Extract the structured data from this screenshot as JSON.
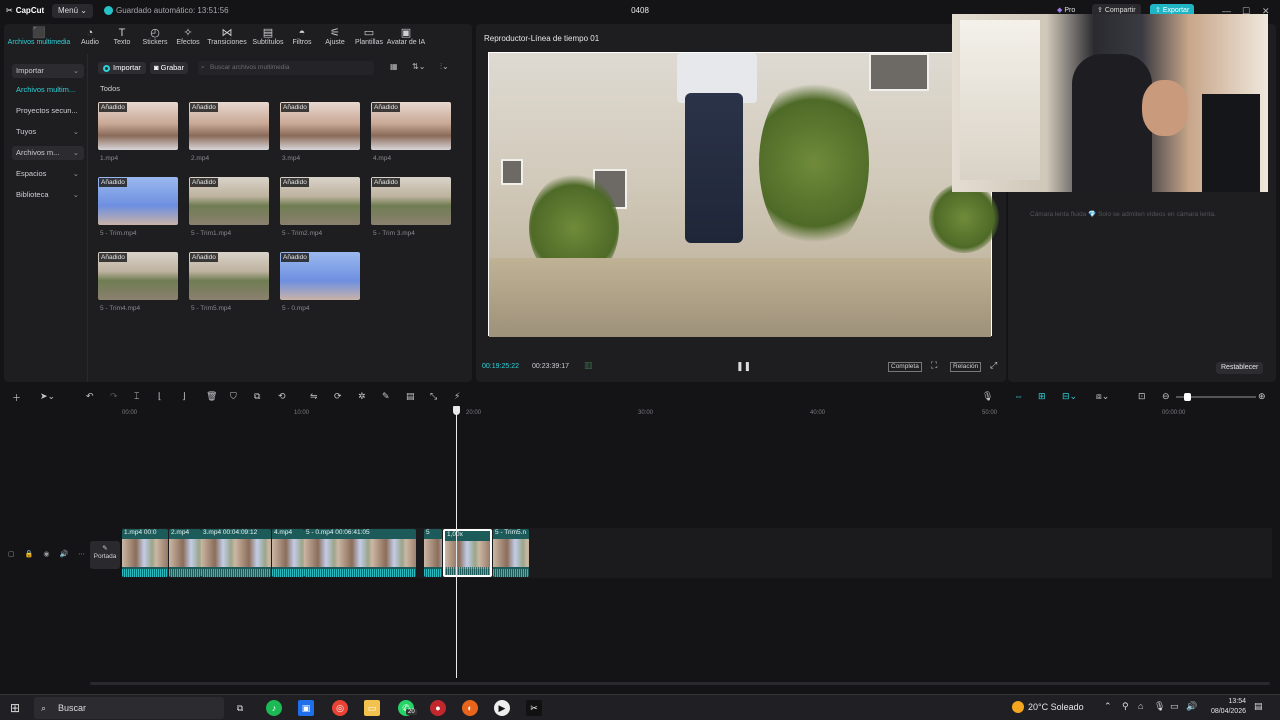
{
  "titlebar": {
    "logo": "CapCut",
    "menu": "Menú ⌄",
    "autosave": "Guardado automático: 13:51:56",
    "title": "0408",
    "pro": "Pro",
    "share": "Compartir",
    "export": "Exportar"
  },
  "toolbar": {
    "items": [
      {
        "label": "Archivos multimedia",
        "icon": "media-icon"
      },
      {
        "label": "Audio",
        "icon": "audio-icon"
      },
      {
        "label": "Texto",
        "icon": "text-icon"
      },
      {
        "label": "Stickers",
        "icon": "sticker-icon"
      },
      {
        "label": "Efectos",
        "icon": "effects-icon"
      },
      {
        "label": "Transiciones",
        "icon": "transition-icon"
      },
      {
        "label": "Subtítulos",
        "icon": "subtitles-icon"
      },
      {
        "label": "Filtros",
        "icon": "filter-icon"
      },
      {
        "label": "Ajuste",
        "icon": "adjust-icon"
      },
      {
        "label": "Plantillas",
        "icon": "template-icon"
      },
      {
        "label": "Avatar de IA",
        "icon": "avatar-icon"
      }
    ]
  },
  "sidenav": {
    "items": [
      {
        "label": "Importar",
        "arrow": "⌄"
      },
      {
        "label": "Archivos multim...",
        "arrow": ""
      },
      {
        "label": "Proyectos secun...",
        "arrow": ""
      },
      {
        "label": "Tuyos",
        "arrow": "⌄"
      },
      {
        "label": "Archivos m...",
        "arrow": "⌄"
      },
      {
        "label": "Espacios",
        "arrow": "⌄"
      },
      {
        "label": "Biblioteca",
        "arrow": "⌄"
      }
    ]
  },
  "media": {
    "import": "Importar",
    "record": "Grabar",
    "search_placeholder": "Buscar archivos multimedia",
    "section": "Todos",
    "badge": "Añadido",
    "items": [
      {
        "name": "1.mp4",
        "kind": "face"
      },
      {
        "name": "2.mp4",
        "kind": "face"
      },
      {
        "name": "3.mp4",
        "kind": "face"
      },
      {
        "name": "4.mp4",
        "kind": "face"
      },
      {
        "name": "5 - Trim.mp4",
        "kind": "sky"
      },
      {
        "name": "5 - Trim1.mp4",
        "kind": "yard"
      },
      {
        "name": "5 - Trim2.mp4",
        "kind": "yard"
      },
      {
        "name": "5 - Trim 3.mp4",
        "kind": "yard"
      },
      {
        "name": "5 - Trim4.mp4",
        "kind": "yard"
      },
      {
        "name": "5 - Trim5.mp4",
        "kind": "yard"
      },
      {
        "name": "5 - 0.mp4",
        "kind": "sky"
      }
    ]
  },
  "player": {
    "title": "Reproductor-Línea de tiempo 01",
    "current": "00:19:25:22",
    "total": "00:23:39:17",
    "full": "Completa",
    "ratio": "Relación"
  },
  "rightpanel": {
    "info": "Cámara lenta fluida 💎 Solo se admiten vídeos en cámara lenta.",
    "reset": "Restablecer"
  },
  "ruler": {
    "ticks": [
      "00:00",
      "10:00",
      "20:00",
      "30:00",
      "40:00",
      "50:00",
      "00:00:00"
    ]
  },
  "timeline": {
    "cover": "Portada",
    "clips": [
      {
        "label": "1.mp4  00:0"
      },
      {
        "label": "2.mp4"
      },
      {
        "label": "3.mp4  00:04:09:12"
      },
      {
        "label": "4.mp4"
      },
      {
        "label": "5 - 0.mp4  00:06:41:05"
      },
      {
        "label": "5"
      },
      {
        "label": "1,00x"
      },
      {
        "label": "5 - Trim5.n"
      }
    ]
  },
  "taskbar": {
    "search": "Buscar",
    "badge": "20",
    "weather": "20°C  Soleado",
    "time": "13:54",
    "date": "08/04/2026"
  }
}
